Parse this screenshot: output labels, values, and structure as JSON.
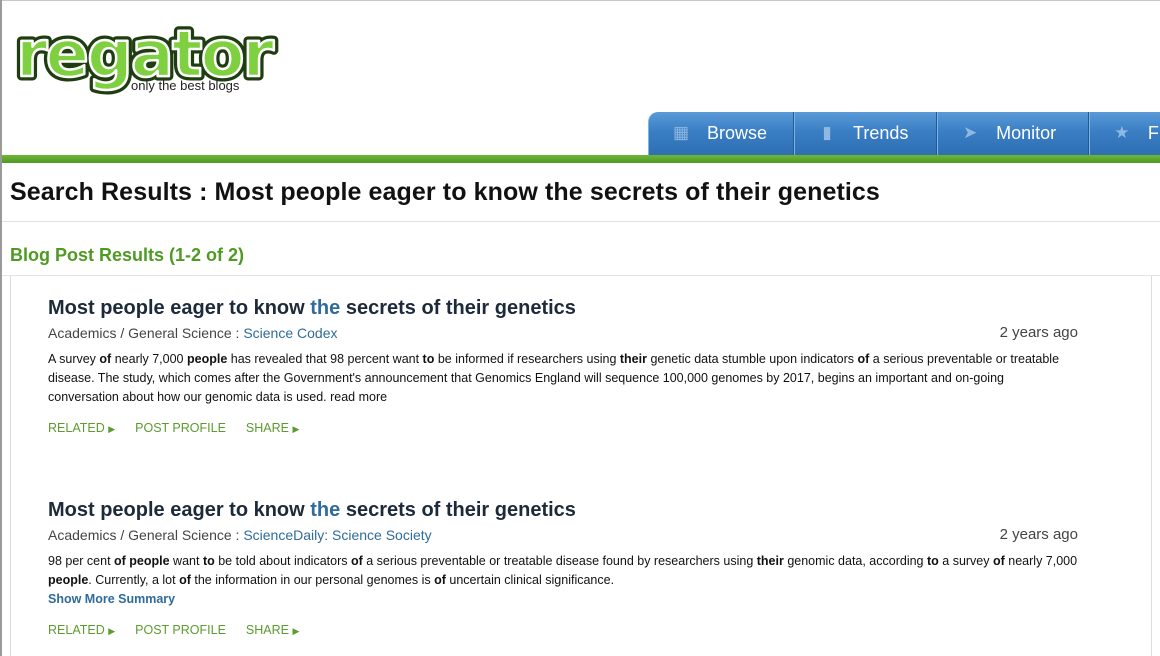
{
  "logo": {
    "text": "regator",
    "tagline": "only the best blogs"
  },
  "nav": {
    "tabs": [
      {
        "label": "Browse",
        "icon": "browse-icon"
      },
      {
        "label": "Trends",
        "icon": "trends-icon"
      },
      {
        "label": "Monitor",
        "icon": "monitor-icon"
      },
      {
        "label": "F",
        "icon": "star-icon"
      }
    ]
  },
  "page": {
    "title": "Search Results : Most people eager to know the secrets of their genetics",
    "section_title": "Blog Post Results (1-2 of 2)"
  },
  "results": [
    {
      "title_a": "Most people eager to know ",
      "title_hl": "the",
      "title_b": " secrets of their genetics",
      "category": "Academics / General Science",
      "separator": " : ",
      "source": "Science Codex",
      "age": "2 years ago",
      "summary": [
        {
          "t": "A survey "
        },
        {
          "b": "of"
        },
        {
          "t": " nearly 7,000 "
        },
        {
          "b": "people"
        },
        {
          "t": " has revealed that 98 percent want "
        },
        {
          "b": "to"
        },
        {
          "t": " be informed if researchers using "
        },
        {
          "b": "their"
        },
        {
          "t": " genetic data stumble upon indicators "
        },
        {
          "b": "of"
        },
        {
          "t": " a serious preventable or treatable disease. The study, which comes after the Government's announcement that Genomics England will sequence 100,000 genomes by 2017, begins an important and on-going conversation about how our genomic data is used. read more"
        }
      ],
      "more_label": "",
      "related_label": "RELATED",
      "profile_label": "POST PROFILE",
      "share_label": "SHARE"
    },
    {
      "title_a": "Most people eager to know ",
      "title_hl": "the",
      "title_b": " secrets of their genetics",
      "category": "Academics / General Science",
      "separator": " : ",
      "source": "ScienceDaily: Science Society",
      "age": "2 years ago",
      "summary": [
        {
          "t": "98 per cent "
        },
        {
          "b": "of people"
        },
        {
          "t": " want "
        },
        {
          "b": "to"
        },
        {
          "t": " be told about indicators "
        },
        {
          "b": "of"
        },
        {
          "t": " a serious preventable or treatable disease found by researchers using "
        },
        {
          "b": "their"
        },
        {
          "t": " genomic data, according "
        },
        {
          "b": "to"
        },
        {
          "t": " a survey "
        },
        {
          "b": "of"
        },
        {
          "t": " nearly 7,000 "
        },
        {
          "b": "people"
        },
        {
          "t": ". Currently, a lot "
        },
        {
          "b": "of"
        },
        {
          "t": " the information in our personal genomes is "
        },
        {
          "b": "of"
        },
        {
          "t": " uncertain clinical significance."
        }
      ],
      "more_label": "Show More Summary",
      "related_label": "RELATED",
      "profile_label": "POST PROFILE",
      "share_label": "SHARE"
    }
  ],
  "colors": {
    "accent_green": "#4f9a22",
    "tab_blue": "#3a7ec4",
    "link_blue": "#2f6b9b"
  }
}
